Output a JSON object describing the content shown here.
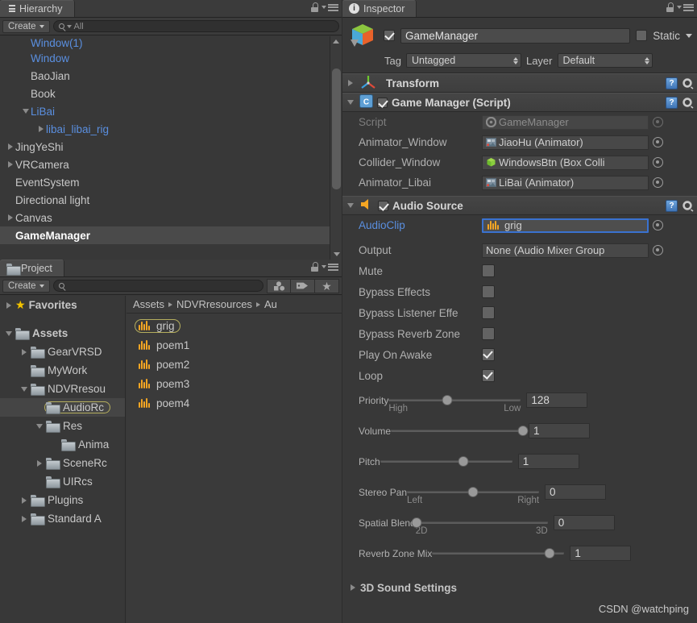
{
  "hierarchy": {
    "tab_label": "Hierarchy",
    "tab_icon": "hierarchy-icon",
    "create_label": "Create",
    "search_placeholder": "All",
    "search_value": "",
    "items": [
      {
        "label": "Window(1)",
        "indent": 2,
        "arrow": "none",
        "style": "prefab",
        "clipped": true
      },
      {
        "label": "Window",
        "indent": 2,
        "arrow": "none",
        "style": "prefab"
      },
      {
        "label": "BaoJian",
        "indent": 2,
        "arrow": "none",
        "style": "normal"
      },
      {
        "label": "Book",
        "indent": 2,
        "arrow": "none",
        "style": "normal"
      },
      {
        "label": "LiBai",
        "indent": 2,
        "arrow": "open",
        "style": "prefab"
      },
      {
        "label": "libai_libai_rig",
        "indent": 3,
        "arrow": "closed",
        "style": "prefab"
      },
      {
        "label": "JingYeShi",
        "indent": 1,
        "arrow": "closed",
        "style": "normal"
      },
      {
        "label": "VRCamera",
        "indent": 1,
        "arrow": "closed",
        "style": "normal"
      },
      {
        "label": "EventSystem",
        "indent": 1,
        "arrow": "none",
        "style": "normal"
      },
      {
        "label": "Directional light",
        "indent": 1,
        "arrow": "none",
        "style": "normal"
      },
      {
        "label": "Canvas",
        "indent": 1,
        "arrow": "closed",
        "style": "normal"
      },
      {
        "label": "GameManager",
        "indent": 1,
        "arrow": "none",
        "style": "selected"
      }
    ]
  },
  "project": {
    "tab_label": "Project",
    "tab_icon": "folder-icon",
    "create_label": "Create",
    "search_placeholder": "",
    "search_value": "",
    "filter_icons": [
      "type-filter-icon",
      "label-filter-icon",
      "favorite-filter-icon"
    ],
    "tree": [
      {
        "label": "Favorites",
        "indent": 0,
        "arrow": "closed",
        "icon": "star",
        "bold": true
      },
      {
        "label": "",
        "indent": 0,
        "arrow": "none",
        "icon": "none",
        "spacer": true
      },
      {
        "label": "Assets",
        "indent": 0,
        "arrow": "open",
        "icon": "folder",
        "bold": true
      },
      {
        "label": "GearVRSD",
        "indent": 1,
        "arrow": "closed",
        "icon": "folder"
      },
      {
        "label": "MyWork",
        "indent": 1,
        "arrow": "none",
        "icon": "folder"
      },
      {
        "label": "NDVRresou",
        "indent": 1,
        "arrow": "open",
        "icon": "folder"
      },
      {
        "label": "AudioRc",
        "indent": 2,
        "arrow": "none",
        "icon": "folder",
        "selected": true
      },
      {
        "label": "Res",
        "indent": 2,
        "arrow": "open",
        "icon": "folder"
      },
      {
        "label": "Anima",
        "indent": 3,
        "arrow": "none",
        "icon": "folder"
      },
      {
        "label": "SceneRc",
        "indent": 2,
        "arrow": "closed",
        "icon": "folder"
      },
      {
        "label": "UIRcs",
        "indent": 2,
        "arrow": "none",
        "icon": "folder"
      },
      {
        "label": "Plugins",
        "indent": 1,
        "arrow": "closed",
        "icon": "folder"
      },
      {
        "label": "Standard A",
        "indent": 1,
        "arrow": "closed",
        "icon": "folder"
      }
    ],
    "breadcrumb": [
      "Assets",
      "NDVRresources",
      "Au"
    ],
    "assets": [
      {
        "label": "grig",
        "icon": "audio-clip-icon",
        "selected": true
      },
      {
        "label": "poem1",
        "icon": "audio-clip-icon",
        "selected": false
      },
      {
        "label": "poem2",
        "icon": "audio-clip-icon",
        "selected": false
      },
      {
        "label": "poem3",
        "icon": "audio-clip-icon",
        "selected": false
      },
      {
        "label": "poem4",
        "icon": "audio-clip-icon",
        "selected": false
      }
    ]
  },
  "inspector": {
    "tab_label": "Inspector",
    "tab_icon": "info-icon",
    "object_name": "GameManager",
    "object_enabled": true,
    "static_label": "Static",
    "static_checked": false,
    "tag_label": "Tag",
    "tag_value": "Untagged",
    "layer_label": "Layer",
    "layer_value": "Default",
    "components": [
      {
        "name": "Transform",
        "icon": "transform-gizmo-icon",
        "expanded": false,
        "has_checkbox": false
      },
      {
        "name": "Game Manager (Script)",
        "icon": "cs-script-icon",
        "expanded": true,
        "has_checkbox": true,
        "checked": true,
        "fields": [
          {
            "label": "Script",
            "value": "GameManager",
            "icon": "cs-script-icon",
            "readonly": true
          },
          {
            "label": "Animator_Window",
            "value": "JiaoHu (Animator)",
            "icon": "animator-icon",
            "readonly": false
          },
          {
            "label": "Collider_Window",
            "value": "WindowsBtn (Box Colli",
            "icon": "box-collider-icon",
            "readonly": false
          },
          {
            "label": "Animator_Libai",
            "value": "LiBai (Animator)",
            "icon": "animator-icon",
            "readonly": false
          }
        ]
      },
      {
        "name": "Audio Source",
        "icon": "audio-source-icon",
        "expanded": true,
        "has_checkbox": true,
        "checked": true
      }
    ],
    "audio_source": {
      "clip_label": "AudioClip",
      "clip_value": "grig",
      "clip_icon": "audio-clip-icon",
      "output_label": "Output",
      "output_value": "None (Audio Mixer Group",
      "toggles": [
        {
          "label": "Mute",
          "checked": false
        },
        {
          "label": "Bypass Effects",
          "checked": false
        },
        {
          "label": "Bypass Listener Effe",
          "checked": false
        },
        {
          "label": "Bypass Reverb Zone",
          "checked": false
        },
        {
          "label": "Play On Awake",
          "checked": true
        },
        {
          "label": "Loop",
          "checked": true
        }
      ],
      "sliders": [
        {
          "label": "Priority",
          "value": "128",
          "pos": 44,
          "left": "High",
          "right": "Low"
        },
        {
          "label": "Volume",
          "value": "1",
          "pos": 100,
          "left": "",
          "right": ""
        },
        {
          "label": "Pitch",
          "value": "1",
          "pos": 63,
          "left": "",
          "right": ""
        },
        {
          "label": "Stereo Pan",
          "value": "0",
          "pos": 50,
          "left": "Left",
          "right": "Right"
        },
        {
          "label": "Spatial Blend",
          "value": "0",
          "pos": 1,
          "left": "2D",
          "right": "3D"
        },
        {
          "label": "Reverb Zone Mix",
          "value": "1",
          "pos": 89,
          "left": "",
          "right": ""
        }
      ],
      "sound_settings_label": "3D Sound Settings"
    }
  },
  "watermark": "CSDN @watchping",
  "colors": {
    "panel_bg": "#383838",
    "tab_bg": "#4b4b4b",
    "accent_blue": "#5a8fe0",
    "selection": "#4a4a4a",
    "audio_orange": "#f5a623",
    "focus_ring": "#3a72d0",
    "highlight_ring": "#b5ae5e"
  }
}
